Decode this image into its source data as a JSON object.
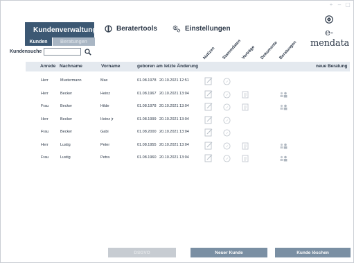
{
  "nav": {
    "kunden": "Kundenverwaltung",
    "berater": "Beratertools",
    "einstellungen": "Einstellungen"
  },
  "subtabs": {
    "kunden": "Kunden",
    "beratungen": "Beratungen"
  },
  "logo": {
    "text": "e-mendata"
  },
  "search": {
    "label": "Kundensuche",
    "value": ""
  },
  "columns": {
    "anrede": "Anrede",
    "nachname": "Nachname",
    "vorname": "Vorname",
    "geboren": "geboren am",
    "letzte": "letzte Änderung",
    "notizen": "Notizen",
    "stammdaten": "Stammdaten",
    "vertraege": "Verträge",
    "dokumente": "Dokumente",
    "beratungen": "Beratungen",
    "neue": "neue Beratung"
  },
  "rows": [
    {
      "anrede": "Herr",
      "nachname": "Mustermann",
      "vorname": "Max",
      "geboren": "01.08.1978",
      "letzte": "20.10.2021 12:51",
      "vertrag": false,
      "beratung": false
    },
    {
      "anrede": "Herr",
      "nachname": "Becker",
      "vorname": "Heinz",
      "geboren": "01.08.1967",
      "letzte": "20.10.2021 13:04",
      "vertrag": true,
      "beratung": true
    },
    {
      "anrede": "Frau",
      "nachname": "Becker",
      "vorname": "Hilde",
      "geboren": "01.08.1978",
      "letzte": "20.10.2021 13:04",
      "vertrag": true,
      "beratung": true
    },
    {
      "anrede": "Herr",
      "nachname": "Becker",
      "vorname": "Heinz jr",
      "geboren": "01.08.1999",
      "letzte": "20.10.2021 13:04",
      "vertrag": false,
      "beratung": false
    },
    {
      "anrede": "Frau",
      "nachname": "Becker",
      "vorname": "Gabi",
      "geboren": "01.08.2000",
      "letzte": "20.10.2021 13:04",
      "vertrag": false,
      "beratung": false
    },
    {
      "anrede": "Herr",
      "nachname": "Lustig",
      "vorname": "Peter",
      "geboren": "01.08.1955",
      "letzte": "20.10.2021 13:04",
      "vertrag": true,
      "beratung": true
    },
    {
      "anrede": "Frau",
      "nachname": "Lustig",
      "vorname": "Petra",
      "geboren": "01.08.1960",
      "letzte": "20.10.2021 13:04",
      "vertrag": true,
      "beratung": true
    }
  ],
  "buttons": {
    "dsgvo": "DSGVO",
    "neu": "Neuer Kunde",
    "loeschen": "Kunde löschen"
  },
  "icons": {
    "notizen": "edit-note-icon",
    "stammdaten": "compass-icon",
    "vertrag": "document-icon",
    "beratung": "users-icon"
  },
  "colors": {
    "primary": "#3c5873",
    "button": "#7a8fa3",
    "disabled": "#c7ccd2",
    "header_bg": "#e4e9ef"
  }
}
